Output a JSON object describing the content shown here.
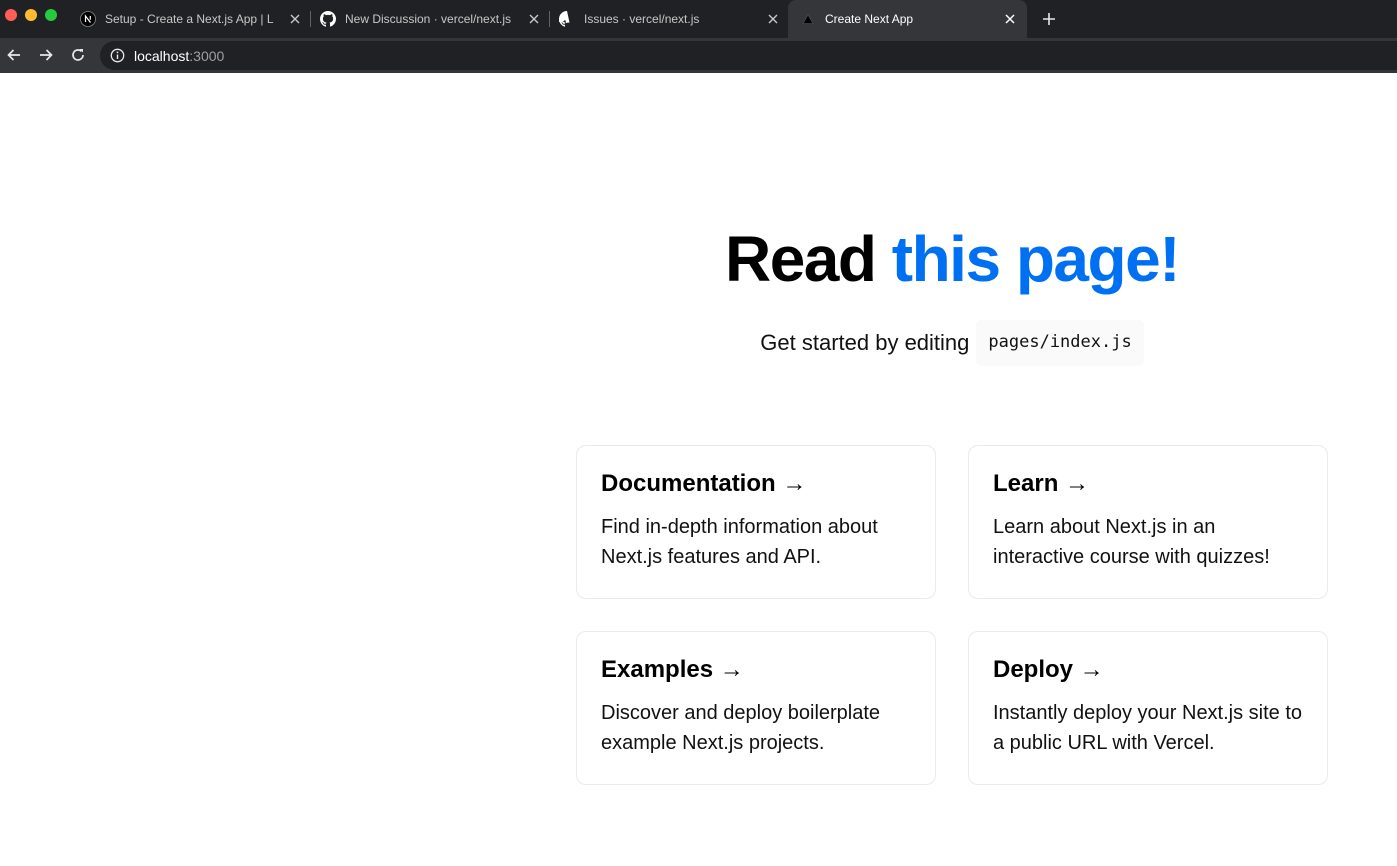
{
  "browser": {
    "tabs": [
      {
        "title": "Setup - Create a Next.js App | L",
        "icon": "nextjs-logo-icon",
        "active": false
      },
      {
        "title": "New Discussion · vercel/next.js",
        "icon": "github-logo-icon",
        "active": false
      },
      {
        "title": "Issues · vercel/next.js",
        "icon": "github-logo-icon",
        "active": false
      },
      {
        "title": "Create Next App",
        "icon": "vercel-triangle-icon",
        "active": true
      }
    ],
    "address": {
      "host": "localhost",
      "port": ":3000"
    }
  },
  "page": {
    "title_prefix": "Read ",
    "title_link": "this page!",
    "description_text": "Get started by editing",
    "description_code": "pages/index.js",
    "cards": [
      {
        "title": "Documentation →",
        "text": "Find in-depth information about Next.js features and API."
      },
      {
        "title": "Learn →",
        "text": "Learn about Next.js in an interactive course with quizzes!"
      },
      {
        "title": "Examples →",
        "text": "Discover and deploy boilerplate example Next.js projects."
      },
      {
        "title": "Deploy →",
        "text": "Instantly deploy your Next.js site to a public URL with Vercel."
      }
    ]
  },
  "colors": {
    "accent": "#0070f3",
    "chrome_dark": "#202124",
    "chrome_tab_active": "#35363a"
  }
}
